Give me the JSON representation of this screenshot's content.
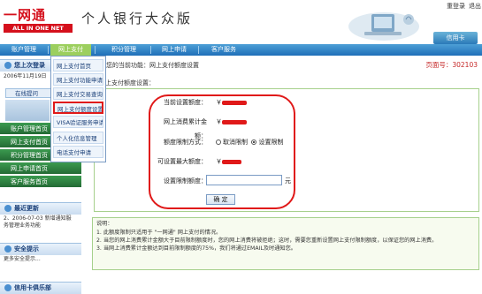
{
  "header": {
    "logo_cn": "一网通",
    "logo_en": "ALL IN ONE NET",
    "title": "个人银行大众版",
    "links": [
      "重登录",
      "退出"
    ],
    "card_button": "信用卡"
  },
  "nav": {
    "items": [
      "账户管理",
      "网上支付",
      "积分管理",
      "网上申请",
      "客户服务"
    ]
  },
  "dropdown": {
    "items": [
      "网上支付首页",
      "网上支付功能申请",
      "网上支付交易查询",
      "网上支付额度设置",
      "VISA验证服务申请",
      "个人化信息管理",
      "电话支付申请"
    ]
  },
  "sidebar": {
    "news_title": "您上次登录",
    "news_text": "2006年11月19日",
    "online_help": "在线提问",
    "menu": [
      "账户管理首页",
      "网上支付首页",
      "积分管理首页",
      "网上申请首页",
      "客户服务首页"
    ],
    "latest_title": "最近更新",
    "latest_text_1": "2、2006-07-03 新增通知服",
    "latest_text_2": "务管理业务功能",
    "safety_title": "安全提示",
    "safety_text": "更多安全提示...",
    "club_title": "信用卡俱乐部"
  },
  "main": {
    "location": "您的当前功能：网上支付额度设置",
    "page_no": "页面号：302103",
    "panel_title": "网上支付额度设置：",
    "fields": {
      "current_limit_label": "当前设置额度：",
      "current_limit_value": "￥",
      "cumulative_label": "网上消费累计金额：",
      "cumulative_value": "￥",
      "restrict_mode_label": "额度限制方式：",
      "restrict_option_cancel": "取消限制",
      "restrict_option_set": "设置限制",
      "max_limit_label": "可设置最大额度：",
      "max_limit_value": "￥",
      "set_limit_label": "设置限制额度：",
      "set_limit_value": "",
      "unit": "元"
    },
    "ok_button": "确 定"
  },
  "notes": {
    "title": "说明：",
    "lines": [
      "1. 此额度限制只适用于 \"一网通\" 网上支付的情况。",
      "2. 当您的网上消费累计金额大于目前限制额度时，您的网上消费将被拒绝；这时，需要您重新设置网上支付限制额度，以保证您的网上消费。",
      "3. 当网上消费累计金额达到目前限制额度的75%，我们将通过EMAIL及时通知您。"
    ]
  },
  "colors": {
    "nav_blue": "#1f6fb8",
    "nav_active_green": "#9ccf5e",
    "annotation_red": "#e01919",
    "page_no_red": "#c62828"
  }
}
